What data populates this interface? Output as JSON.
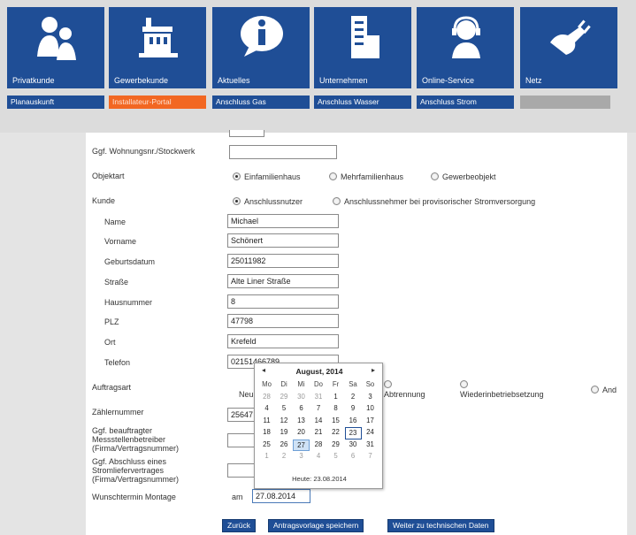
{
  "nav_tiles": [
    {
      "label": "Privatkunde",
      "icon": "family-icon"
    },
    {
      "label": "Gewerbekunde",
      "icon": "building-icon"
    },
    {
      "label": "Aktuelles",
      "icon": "info-icon"
    },
    {
      "label": "Unternehmen",
      "icon": "office-tower-icon"
    },
    {
      "label": "Online-Service",
      "icon": "headset-icon"
    },
    {
      "label": "Netz",
      "icon": "plug-icon"
    }
  ],
  "sub_tabs": [
    {
      "label": "Planauskunft",
      "active": false
    },
    {
      "label": "Installateur-Portal",
      "active": true
    },
    {
      "label": "Anschluss Gas",
      "active": false
    },
    {
      "label": "Anschluss Wasser",
      "active": false
    },
    {
      "label": "Anschluss Strom",
      "active": false
    }
  ],
  "form": {
    "wohnung_label": "Ggf. Wohnungsnr./Stockwerk",
    "wohnung_value": "",
    "objektart_label": "Objektart",
    "objektart_options": [
      "Einfamilienhaus",
      "Mehrfamilienhaus",
      "Gewerbeobjekt"
    ],
    "objektart_selected": "Einfamilienhaus",
    "kunde_label": "Kunde",
    "kunde_options": [
      "Anschlussnutzer",
      "Anschlussnehmer bei provisorischer Stromversorgung"
    ],
    "kunde_selected": "Anschlussnutzer",
    "name_label": "Name",
    "name_value": "Michael",
    "vorname_label": "Vorname",
    "vorname_value": "Schönert",
    "geburtsdatum_label": "Geburtsdatum",
    "geburtsdatum_value": "25011982",
    "strasse_label": "Straße",
    "strasse_value": "Alte Liner Straße",
    "hausnummer_label": "Hausnummer",
    "hausnummer_value": "8",
    "plz_label": "PLZ",
    "plz_value": "47798",
    "ort_label": "Ort",
    "ort_value": "Krefeld",
    "telefon_label": "Telefon",
    "telefon_value": "02151466789",
    "auftragsart_label": "Auftragsart",
    "auftragsart_options": [
      "Neu",
      "Abtrennung",
      "Wiederinbetriebsetzung",
      "And"
    ],
    "zaehlernummer_label": "Zählernummer",
    "zaehlernummer_value": "25647",
    "messstellen_label": "Ggf. beauftragter Messstellenbetreiber (Firma/Vertragsnummer)",
    "messstellen_value": "",
    "stromliefer_label": "Ggf. Abschluss eines Stromliefervertrages (Firma/Vertragsnummer)",
    "stromliefer_value": "",
    "wunschtermin_label": "Wunschtermin Montage",
    "wunschtermin_prefix": "am",
    "wunschtermin_value": "27.08.2014"
  },
  "calendar": {
    "title": "August, 2014",
    "prev": "◂",
    "next": "▸",
    "weekdays": [
      "Mo",
      "Di",
      "Mi",
      "Do",
      "Fr",
      "Sa",
      "So"
    ],
    "weeks": [
      [
        "28",
        "29",
        "30",
        "31",
        "1",
        "2",
        "3"
      ],
      [
        "4",
        "5",
        "6",
        "7",
        "8",
        "9",
        "10"
      ],
      [
        "11",
        "12",
        "13",
        "14",
        "15",
        "16",
        "17"
      ],
      [
        "18",
        "19",
        "20",
        "21",
        "22",
        "23",
        "24"
      ],
      [
        "25",
        "26",
        "27",
        "28",
        "29",
        "30",
        "31"
      ],
      [
        "1",
        "2",
        "3",
        "4",
        "5",
        "6",
        "7"
      ]
    ],
    "today": "23",
    "selected": "27",
    "footer": "Heute: 23.08.2014"
  },
  "buttons": {
    "back": "Zurück",
    "save": "Antragsvorlage speichern",
    "next": "Weiter zu technischen Daten"
  },
  "colors": {
    "brand_blue": "#1f4e96",
    "active_orange": "#f26722"
  }
}
